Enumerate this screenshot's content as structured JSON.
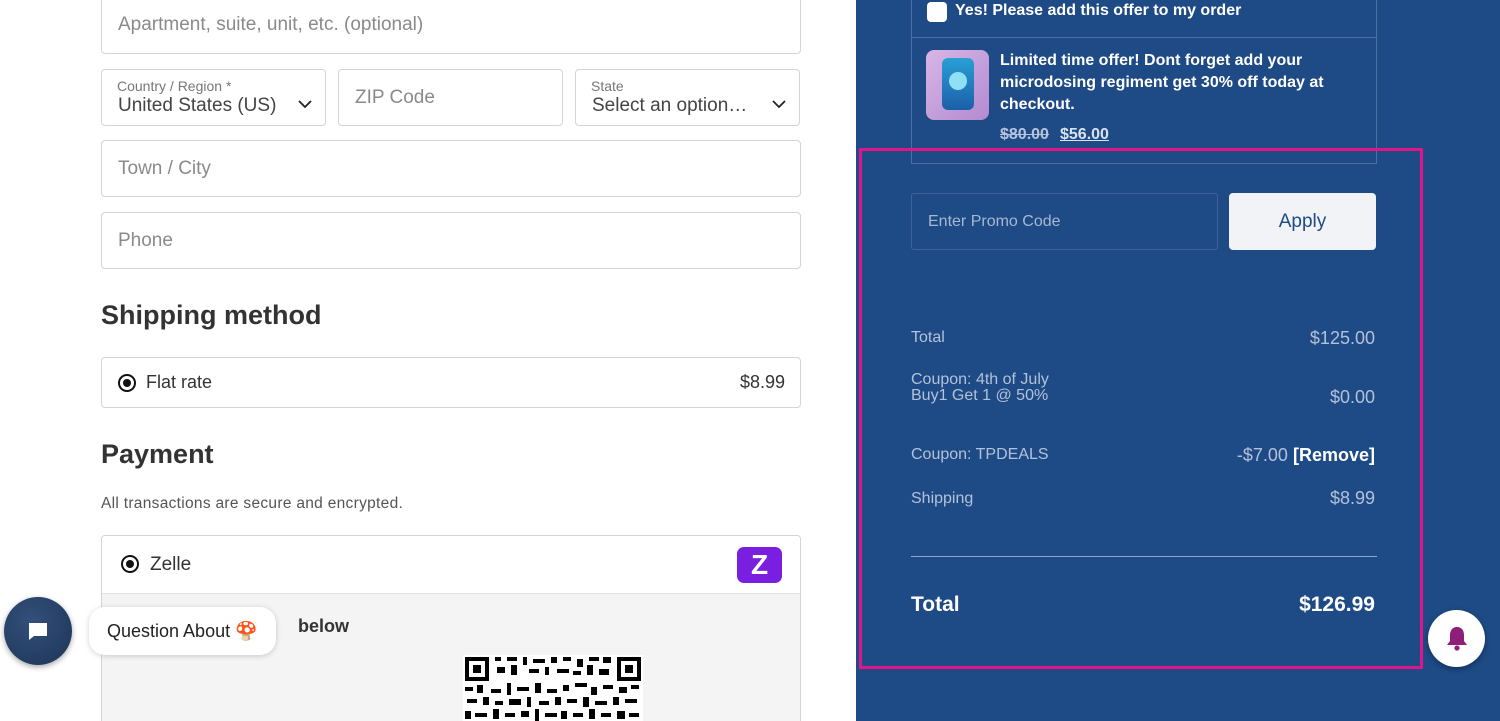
{
  "address": {
    "apartment_placeholder": "Apartment, suite, unit, etc. (optional)",
    "country_label": "Country / Region *",
    "country_value": "United States (US)",
    "zip_placeholder": "ZIP Code",
    "state_label": "State",
    "state_value": "Select an option…",
    "city_placeholder": "Town / City",
    "phone_placeholder": "Phone"
  },
  "shipping": {
    "heading": "Shipping method",
    "option_label": "Flat rate",
    "option_price": "$8.99"
  },
  "payment": {
    "heading": "Payment",
    "note": "All transactions are secure and encrypted.",
    "method_label": "Zelle",
    "body_text": "below"
  },
  "offer": {
    "checkbox_label": "Yes! Please add this offer to my order",
    "description": "Limited time offer! Dont forget add your microdosing regiment get 30% off today at checkout.",
    "old_price": "$80.00",
    "new_price": "$56.00"
  },
  "promo": {
    "placeholder": "Enter Promo Code",
    "apply_label": "Apply"
  },
  "summary": {
    "total_label": "Total",
    "total_value": "$125.00",
    "coupon1_label": "Coupon: 4th of July Buy1 Get 1 @ 50%",
    "coupon1_value": "$0.00",
    "coupon2_label": "Coupon: TPDEALS",
    "coupon2_value": "-$7.00",
    "remove_label": "[Remove]",
    "shipping_label": "Shipping",
    "shipping_value": "$8.99",
    "grand_total_label": "Total",
    "grand_total_value": "$126.99"
  },
  "chat": {
    "bubble_text": "Question About 🍄"
  },
  "colors": {
    "panel_bg": "#1e4a85",
    "highlight": "#e0158a",
    "zelle": "#7a1fe0"
  },
  "icons": {
    "chat": "chat-icon",
    "bell": "bell-icon",
    "chevron": "chevron-down-icon",
    "zelle": "zelle-logo-icon"
  }
}
